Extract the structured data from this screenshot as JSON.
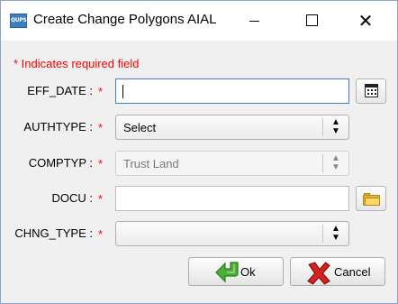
{
  "window": {
    "title": "Create Change Polygons AIAL",
    "app_icon_text": "QUPS",
    "minimize": "minimize",
    "maximize": "maximize",
    "close_symbol": "✕"
  },
  "required_note": "* Indicates required field",
  "required_star": "*",
  "fields": {
    "eff_date": {
      "label": "EFF_DATE :",
      "value": ""
    },
    "authtype": {
      "label": "AUTHTYPE :",
      "value": "Select"
    },
    "comptyp": {
      "label": "COMPTYP :",
      "value": "Trust Land"
    },
    "docu": {
      "label": "DOCU :",
      "value": ""
    },
    "chng_type": {
      "label": "CHNG_TYPE :",
      "value": ""
    }
  },
  "icons": {
    "calendar": "calendar-icon",
    "folder": "folder-icon",
    "ok": "green-arrow-icon",
    "cancel": "red-x-icon",
    "dropdown": "up-down-arrow-icon"
  },
  "buttons": {
    "ok": "Ok",
    "cancel": "Cancel"
  },
  "colors": {
    "required": "#ff0000",
    "focus_border": "#3c7fd6",
    "ok_green": "#3a9a2c",
    "cancel_red": "#c41414",
    "folder_yellow": "#e8b430"
  }
}
